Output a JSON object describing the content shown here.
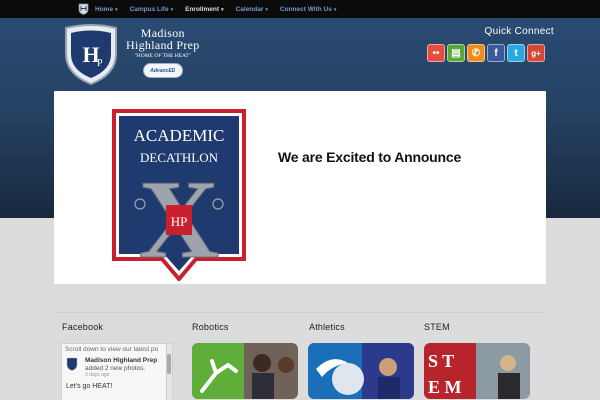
{
  "nav": {
    "items": [
      {
        "label": "Home",
        "active": false
      },
      {
        "label": "Campus Life",
        "active": false
      },
      {
        "label": "Enrollment",
        "active": true
      },
      {
        "label": "Calendar",
        "active": false
      },
      {
        "label": "Connect With Us",
        "active": false
      }
    ],
    "caret": "▾"
  },
  "school": {
    "name_line1": "Madison",
    "name_line2": "Highland Prep",
    "tagline": "\"HOME OF THE HEAT\"",
    "accreditation": "AdvancED",
    "crest_letters": "HP"
  },
  "quick_connect": {
    "title": "Quick Connect",
    "icons": [
      {
        "name": "flickr-icon",
        "glyph": "••"
      },
      {
        "name": "calendar-icon",
        "glyph": "▤"
      },
      {
        "name": "phone-icon",
        "glyph": "✆"
      },
      {
        "name": "facebook-icon",
        "glyph": "f"
      },
      {
        "name": "twitter-icon",
        "glyph": "t"
      },
      {
        "name": "google-plus-icon",
        "glyph": "g+"
      }
    ]
  },
  "slider": {
    "badge_line1": "ACADEMIC",
    "badge_line2": "DECATHLON",
    "badge_letter": "X",
    "headline": "We are Excited to Announce"
  },
  "facebook": {
    "title": "Facebook",
    "scroll_hint": "Scroll down to view our latest po",
    "post_name": "Madison Highland Prep",
    "post_action": "added 2 new photos.",
    "post_time": "3 days ago",
    "post_message": "Let's go HEAT!"
  },
  "sections": [
    {
      "title": "Robotics"
    },
    {
      "title": "Athletics"
    },
    {
      "title": "STEM"
    }
  ],
  "colors": {
    "nav_bg": "#0b0b0b",
    "nav_link": "#6f9bd0",
    "header_blue": "#274467",
    "crest_red": "#c8202f",
    "badge_navy": "#1f3a6e"
  }
}
